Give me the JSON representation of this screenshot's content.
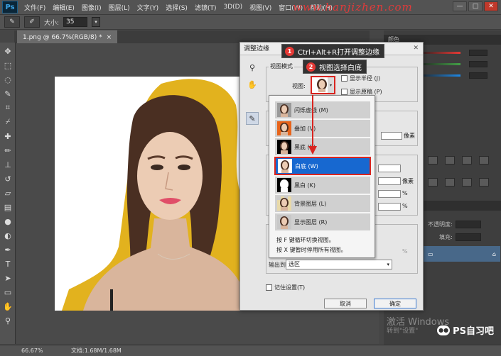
{
  "app": {
    "logo": "Ps"
  },
  "menu": [
    "文件(F)",
    "编辑(E)",
    "图像(I)",
    "图层(L)",
    "文字(Y)",
    "选择(S)",
    "滤镜(T)",
    "3D(D)",
    "视图(V)",
    "窗口(W)",
    "帮助(H)"
  ],
  "watermark_top": "www.hanjizhen.com",
  "window_buttons": [
    "—",
    "□",
    "✕"
  ],
  "options": {
    "size_label": "大小:",
    "size_value": "35",
    "drop_arrow": "▾"
  },
  "document": {
    "tab": "1.png @ 66.7%(RGB/8) *",
    "tab_close": "×"
  },
  "status": {
    "zoom": "66.67%",
    "doc_info": "文档:1.68M/1.68M"
  },
  "watermark_brand": "PS自习吧",
  "activate_windows": {
    "line1": "激活 Windows",
    "line2": "转到\"设置\""
  },
  "panels": {
    "color_tab": "颜色",
    "layers_tab": "图层",
    "layer_opacity_label": "不透明度:",
    "layer_fill_label": "填充:"
  },
  "dialog": {
    "title": "调整边缘",
    "close": "✕",
    "view_mode_label": "视图模式",
    "view_label": "视图:",
    "show_radius": "显示半径 (J)",
    "show_original": "显示原稿 (P)",
    "unit_px": "像素",
    "unit_pct": "%",
    "output_label": "输出到(O):",
    "output_value": "选区",
    "remember": "记住设置(T)",
    "cancel": "取消",
    "ok": "确定"
  },
  "view_options": [
    {
      "label": "闪烁虚线 (M)",
      "bg": "#9a9a9a"
    },
    {
      "label": "叠加 (V)",
      "bg": "#e8641a"
    },
    {
      "label": "黑底 (B)",
      "bg": "#000000"
    },
    {
      "label": "白底 (W)",
      "bg": "#ffffff"
    },
    {
      "label": "黑白 (K)",
      "bg": "#000000"
    },
    {
      "label": "背景图层 (L)",
      "bg": "#e8d9a8"
    },
    {
      "label": "显示图层 (R)",
      "bg": "#c8c8c8"
    }
  ],
  "selected_view": 3,
  "view_hints": [
    "按 F 键循环切换视图。",
    "按 X 键暂时停用所有视图。"
  ],
  "callouts": [
    {
      "num": "1",
      "text": "Ctrl+Alt+R打开调整边缘"
    },
    {
      "num": "2",
      "text": "视图选择白底"
    }
  ],
  "colors": {
    "highlight": "#1768d0",
    "annotation_red": "#d9241f",
    "yellow_overlay": "#e2b21e"
  }
}
